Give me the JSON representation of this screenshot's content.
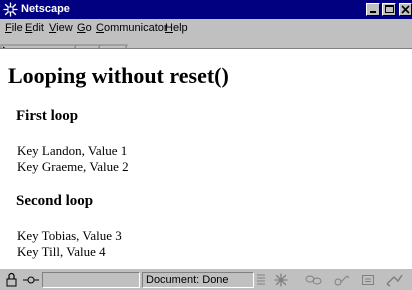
{
  "window": {
    "title": "Netscape"
  },
  "menu": {
    "items": [
      {
        "key": "F",
        "rest": "ile"
      },
      {
        "key": "E",
        "rest": "dit"
      },
      {
        "key": "V",
        "rest": "iew"
      },
      {
        "key": "G",
        "rest": "o"
      },
      {
        "key": "C",
        "rest": "ommunicator"
      },
      {
        "key": "H",
        "rest": "elp"
      }
    ]
  },
  "page": {
    "heading": "Looping without reset()",
    "sections": [
      {
        "title": "First loop",
        "lines": [
          "Key Landon, Value 1",
          "Key Graeme, Value 2"
        ]
      },
      {
        "title": "Second loop",
        "lines": [
          "Key Tobias, Value 3",
          "Key Till, Value 4"
        ]
      }
    ]
  },
  "status": {
    "text": "Document: Done"
  },
  "icons": {
    "app": "netscape-logo-icon",
    "security": "lock-icon",
    "progress": "connection-icon",
    "navigator": "navigator-icon",
    "mail": "mail-icon",
    "discussions": "discussion-icon",
    "composer": "composer-icon",
    "bookmarks": "bookmark-icon"
  }
}
